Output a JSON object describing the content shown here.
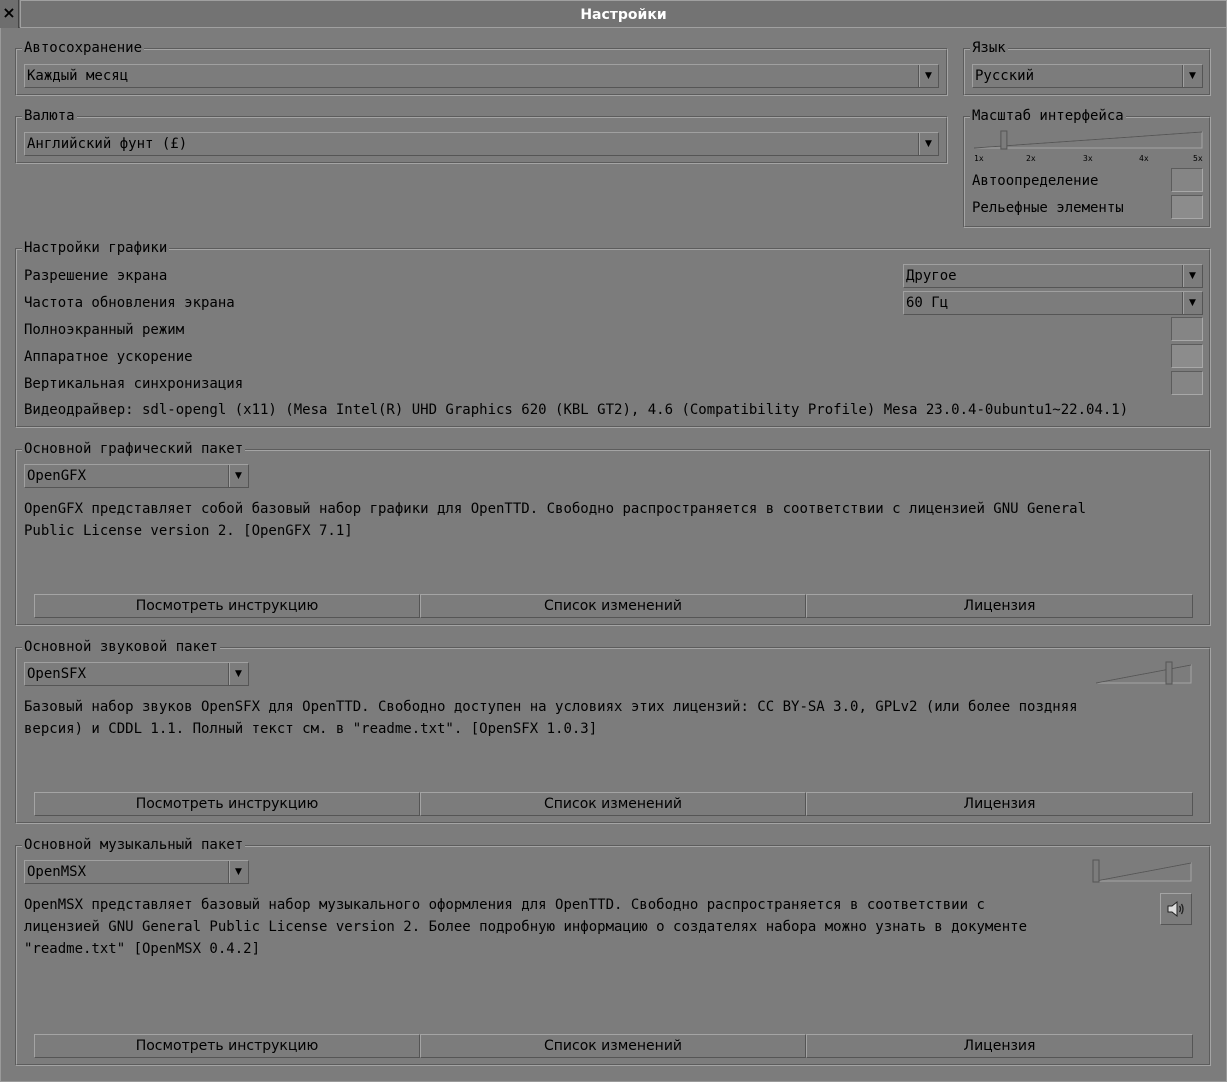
{
  "window": {
    "title": "Настройки",
    "close_label": "×"
  },
  "autosave": {
    "label": "Автосохранение",
    "value": "Каждый месяц"
  },
  "language": {
    "label": "Язык",
    "value": "Русский"
  },
  "currency": {
    "label": "Валюта",
    "value": "Английский фунт (£)"
  },
  "ui_scale": {
    "label": "Масштаб интерфейса",
    "ticks": [
      "1x",
      "2x",
      "3x",
      "4x",
      "5x"
    ],
    "level_fraction": 0.125,
    "auto_label": "Автоопределение",
    "bevels_label": "Рельефные элементы"
  },
  "graphics": {
    "label": "Настройки графики",
    "resolution_label": "Разрешение экрана",
    "resolution_value": "Другое",
    "refresh_label": "Частота обновления экрана",
    "refresh_value": "60 Гц",
    "fullscreen_label": "Полноэкранный режим",
    "hw_accel_label": "Аппаратное ускорение",
    "vsync_label": "Вертикальная синхронизация",
    "driver_info": "Видеодрайвер: sdl-opengl (x11) (Mesa Intel(R) UHD Graphics 620 (KBL GT2), 4.6 (Compatibility Profile) Mesa 23.0.4-0ubuntu1~22.04.1)"
  },
  "base_graphics": {
    "label": "Основной графический пакет",
    "value": "OpenGFX",
    "description": "OpenGFX представляет собой базовый набор графики для OpenTTD. Свободно распространяется в соответствии с лицензией GNU General\nPublic License version 2. [OpenGFX 7.1]",
    "buttons": [
      "Посмотреть инструкцию",
      "Список изменений",
      "Лицензия"
    ]
  },
  "base_sounds": {
    "label": "Основной звуковой пакет",
    "value": "OpenSFX",
    "volume_fraction": 0.78,
    "description": "Базовый набор звуков OpenSFX для OpenTTD. Свободно доступен на условиях этих лицензий: CC BY-SA 3.0, GPLv2 (или более поздняя\nверсия) и CDDL 1.1. Полный текст см. в \"readme.txt\". [OpenSFX 1.0.3]",
    "buttons": [
      "Посмотреть инструкцию",
      "Список изменений",
      "Лицензия"
    ]
  },
  "base_music": {
    "label": "Основной музыкальный пакет",
    "value": "OpenMSX",
    "volume_fraction": 0.0,
    "description": "OpenMSX представляет базовый набор музыкального оформления для OpenTTD. Свободно распространяется в соответствии с\nлицензией GNU General Public License version 2. Более подробную информацию о создателях набора можно узнать в документе\n\"readme.txt\" [OpenMSX 0.4.2]",
    "buttons": [
      "Посмотреть инструкцию",
      "Список изменений",
      "Лицензия"
    ]
  }
}
